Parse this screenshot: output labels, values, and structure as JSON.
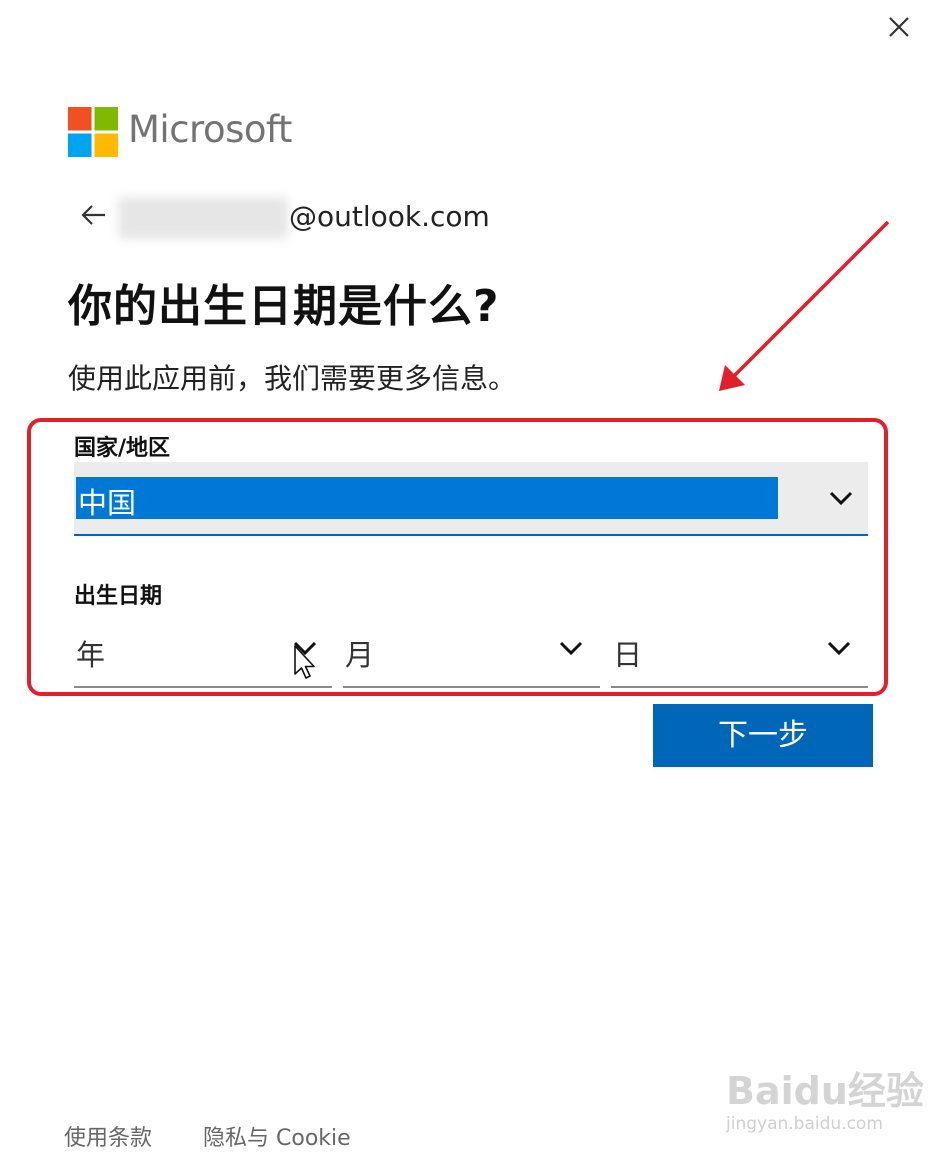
{
  "dialog": {
    "brand_name": "Microsoft",
    "email_suffix": "@outlook.com",
    "heading": "你的出生日期是什么?",
    "subtitle": "使用此应用前，我们需要更多信息。"
  },
  "country_field": {
    "label": "国家/地区",
    "selected": "中国"
  },
  "birthdate_field": {
    "label": "出生日期",
    "year_value": "年",
    "month_value": "月",
    "day_value": "日"
  },
  "actions": {
    "next_label": "下一步"
  },
  "footer": {
    "terms_label": "使用条款",
    "privacy_label": "隐私与 Cookie"
  },
  "watermark": {
    "main": "Baidu经验",
    "sub": "jingyan.baidu.com"
  },
  "colors": {
    "accent": "#0067b8",
    "selection": "#0078d7",
    "annotation": "#e0202b",
    "logo": [
      "#f25022",
      "#7fba00",
      "#00a4ef",
      "#ffb900"
    ]
  },
  "icons": [
    "close-icon",
    "microsoft-logo",
    "back-arrow-icon",
    "chevron-down-icon",
    "cursor-arrow-icon",
    "annotation-arrow"
  ]
}
